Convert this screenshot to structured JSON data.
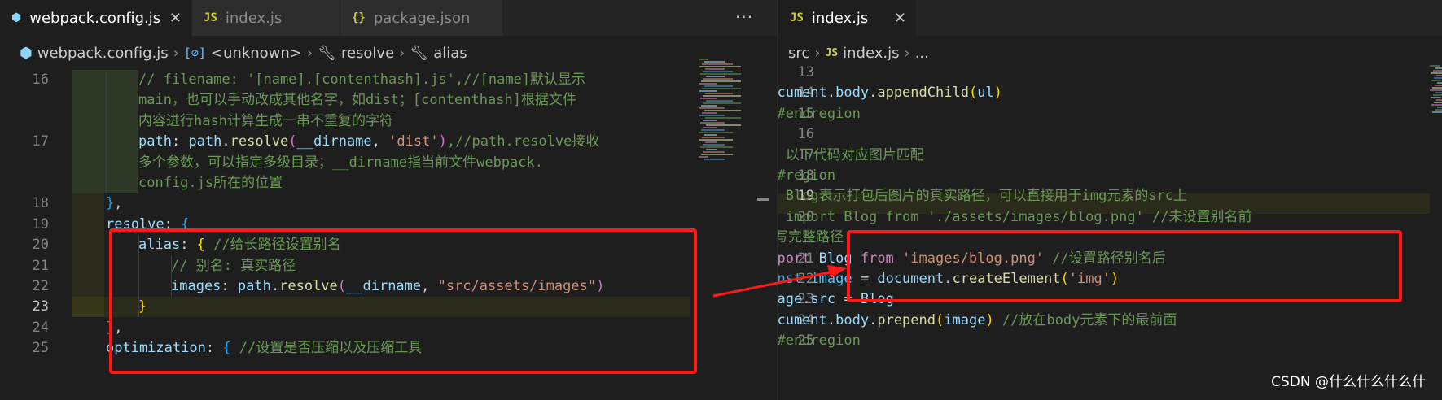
{
  "left": {
    "tabs": [
      {
        "label": "webpack.config.js",
        "icon": "webpack-icon",
        "active": true,
        "closable": true
      },
      {
        "label": "index.js",
        "icon": "js-icon",
        "active": false
      },
      {
        "label": "package.json",
        "icon": "json-icon",
        "active": false
      }
    ],
    "more_label": "···",
    "breadcrumb": {
      "file": "webpack.config.js",
      "unknown": "<unknown>",
      "resolve": "resolve",
      "alias": "alias"
    },
    "lines": [
      {
        "num": "16",
        "parts": [
          {
            "t": "// filename: '[name].[contenthash].js',//[name]默认显示",
            "c": "comment"
          }
        ]
      },
      {
        "num": "",
        "parts": [
          {
            "t": "main，也可以手动改成其他名字，如dist；[contenthash]根据文件",
            "c": "comment"
          }
        ]
      },
      {
        "num": "",
        "parts": [
          {
            "t": "内容进行hash计算生成一串不重复的字符",
            "c": "comment"
          }
        ]
      },
      {
        "num": "17",
        "parts": [
          {
            "t": "path",
            "c": "prop"
          },
          {
            "t": ": ",
            "c": "punct"
          },
          {
            "t": "path",
            "c": "var"
          },
          {
            "t": ".",
            "c": "punct"
          },
          {
            "t": "resolve",
            "c": "func"
          },
          {
            "t": "(",
            "c": "brace2"
          },
          {
            "t": "__dirname",
            "c": "var"
          },
          {
            "t": ", ",
            "c": "punct"
          },
          {
            "t": "'dist'",
            "c": "string"
          },
          {
            "t": ")",
            "c": "brace2"
          },
          {
            "t": ",//path.resolve接收",
            "c": "comment"
          }
        ]
      },
      {
        "num": "",
        "parts": [
          {
            "t": "多个参数，可以指定多级目录；__dirname指当前文件webpack.",
            "c": "comment"
          }
        ]
      },
      {
        "num": "",
        "parts": [
          {
            "t": "config.js所在的位置",
            "c": "comment"
          }
        ]
      },
      {
        "num": "18",
        "parts": [
          {
            "t": "}",
            "c": "brace3"
          },
          {
            "t": ",",
            "c": "punct"
          }
        ]
      },
      {
        "num": "19",
        "parts": [
          {
            "t": "resolve",
            "c": "prop"
          },
          {
            "t": ": ",
            "c": "punct"
          },
          {
            "t": "{",
            "c": "brace3"
          }
        ]
      },
      {
        "num": "20",
        "parts": [
          {
            "t": "alias",
            "c": "prop"
          },
          {
            "t": ": ",
            "c": "punct"
          },
          {
            "t": "{",
            "c": "brace"
          },
          {
            "t": " //给长路径设置别名",
            "c": "comment"
          }
        ]
      },
      {
        "num": "21",
        "parts": [
          {
            "t": "// 别名: 真实路径",
            "c": "comment"
          }
        ]
      },
      {
        "num": "22",
        "parts": [
          {
            "t": "images",
            "c": "prop"
          },
          {
            "t": ": ",
            "c": "punct"
          },
          {
            "t": "path",
            "c": "var"
          },
          {
            "t": ".",
            "c": "punct"
          },
          {
            "t": "resolve",
            "c": "func"
          },
          {
            "t": "(",
            "c": "brace2"
          },
          {
            "t": "__dirname",
            "c": "var"
          },
          {
            "t": ", ",
            "c": "punct"
          },
          {
            "t": "\"src/assets/images\"",
            "c": "string"
          },
          {
            "t": ")",
            "c": "brace2"
          }
        ]
      },
      {
        "num": "23",
        "parts": [
          {
            "t": "}",
            "c": "brace"
          }
        ]
      },
      {
        "num": "24",
        "parts": [
          {
            "t": "}",
            "c": "brace3"
          },
          {
            "t": ",",
            "c": "punct"
          }
        ]
      },
      {
        "num": "25",
        "parts": [
          {
            "t": "optimization",
            "c": "prop"
          },
          {
            "t": ": ",
            "c": "punct"
          },
          {
            "t": "{",
            "c": "brace3"
          },
          {
            "t": " //设置是否压缩以及压缩工具",
            "c": "comment"
          }
        ]
      }
    ]
  },
  "right": {
    "tabs": [
      {
        "label": "index.js",
        "icon": "js-icon",
        "active": true,
        "closable": true
      }
    ],
    "more_label": "···",
    "breadcrumb": {
      "folder": "src",
      "file": "index.js",
      "more": "..."
    },
    "lines": [
      {
        "num": "13",
        "parts": [
          {
            "t": "})",
            "c": "brace"
          }
        ]
      },
      {
        "num": "14",
        "parts": [
          {
            "t": "document",
            "c": "var"
          },
          {
            "t": ".",
            "c": "punct"
          },
          {
            "t": "body",
            "c": "var"
          },
          {
            "t": ".",
            "c": "punct"
          },
          {
            "t": "appendChild",
            "c": "func"
          },
          {
            "t": "(",
            "c": "brace"
          },
          {
            "t": "ul",
            "c": "var"
          },
          {
            "t": ")",
            "c": "brace"
          }
        ]
      },
      {
        "num": "15",
        "parts": [
          {
            "t": "//#endregion",
            "c": "comment"
          }
        ]
      },
      {
        "num": "16",
        "parts": []
      },
      {
        "num": "17",
        "parts": [
          {
            "t": "// 以下代码对应图片匹配",
            "c": "comment"
          }
        ]
      },
      {
        "num": "18",
        "parts": [
          {
            "t": "//#region",
            "c": "comment"
          }
        ]
      },
      {
        "num": "19",
        "parts": [
          {
            "t": "// Blog表示打包后图片的真实路径，可以直接用于img元素的src上",
            "c": "comment"
          }
        ]
      },
      {
        "num": "20",
        "parts": [
          {
            "t": "// import Blog from './assets/images/blog.png' //未设置别名前",
            "c": "comment"
          }
        ]
      },
      {
        "num": "",
        "parts": [
          {
            "t": "需写完整路径",
            "c": "comment"
          }
        ]
      },
      {
        "num": "21",
        "parts": [
          {
            "t": "import",
            "c": "keyword"
          },
          {
            "t": " Blog ",
            "c": "var"
          },
          {
            "t": "from",
            "c": "keyword"
          },
          {
            "t": " ",
            "c": "punct"
          },
          {
            "t": "'images/blog.png'",
            "c": "string"
          },
          {
            "t": " //设置路径别名后",
            "c": "comment"
          }
        ]
      },
      {
        "num": "22",
        "parts": [
          {
            "t": "const",
            "c": "keyword2"
          },
          {
            "t": " ",
            "c": "punct"
          },
          {
            "t": "image",
            "c": "const"
          },
          {
            "t": " = ",
            "c": "punct"
          },
          {
            "t": "document",
            "c": "var"
          },
          {
            "t": ".",
            "c": "punct"
          },
          {
            "t": "createElement",
            "c": "func"
          },
          {
            "t": "(",
            "c": "brace"
          },
          {
            "t": "'img'",
            "c": "string"
          },
          {
            "t": ")",
            "c": "brace"
          }
        ]
      },
      {
        "num": "23",
        "parts": [
          {
            "t": "image",
            "c": "var"
          },
          {
            "t": ".",
            "c": "punct"
          },
          {
            "t": "src",
            "c": "var"
          },
          {
            "t": " = ",
            "c": "punct"
          },
          {
            "t": "Blog",
            "c": "var"
          }
        ]
      },
      {
        "num": "24",
        "parts": [
          {
            "t": "document",
            "c": "var"
          },
          {
            "t": ".",
            "c": "punct"
          },
          {
            "t": "body",
            "c": "var"
          },
          {
            "t": ".",
            "c": "punct"
          },
          {
            "t": "prepend",
            "c": "func"
          },
          {
            "t": "(",
            "c": "brace"
          },
          {
            "t": "image",
            "c": "var"
          },
          {
            "t": ")",
            "c": "brace"
          },
          {
            "t": " //放在body元素下的最前面",
            "c": "comment"
          }
        ]
      },
      {
        "num": "25",
        "parts": [
          {
            "t": "//#endregion",
            "c": "comment"
          }
        ]
      }
    ]
  },
  "watermark": "CSDN @什么什么什么什"
}
